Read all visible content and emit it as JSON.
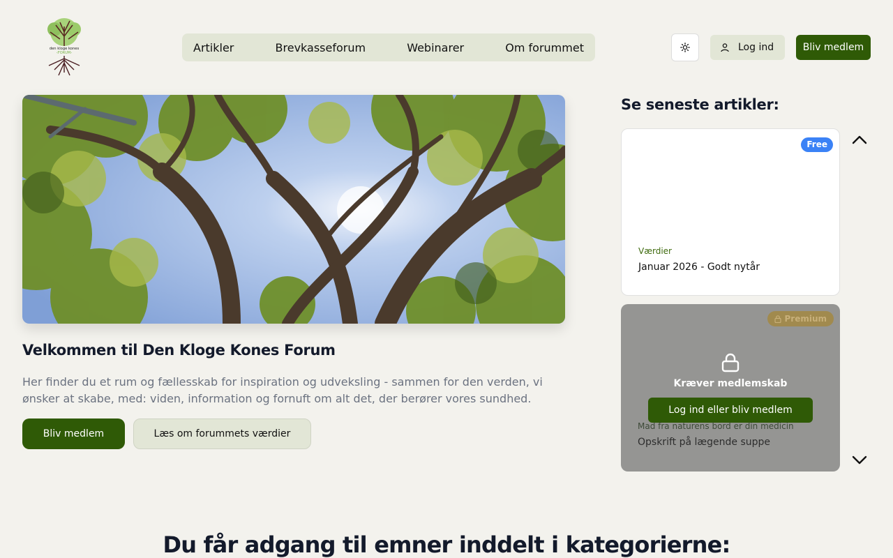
{
  "brand": {
    "logo_alt_line1": "den kloge kones",
    "logo_alt_line2": "FORUM"
  },
  "nav": {
    "items": [
      {
        "label": "Artikler"
      },
      {
        "label": "Brevkasseforum"
      },
      {
        "label": "Webinarer"
      },
      {
        "label": "Om forummet"
      }
    ]
  },
  "header": {
    "theme_icon": "sun-icon",
    "login_label": "Log ind",
    "login_icon": "user-icon",
    "join_label": "Bliv medlem"
  },
  "hero": {
    "title": "Velkommen til Den Kloge Kones Forum",
    "text": "Her finder du et rum og fællesskab for inspiration og udveksling - sammen for den verden, vi ønsker at skabe, med: viden, information og fornuft om alt det, der berører vores sundhed.",
    "join_label": "Bliv medlem",
    "values_label": "Læs om forummets værdier"
  },
  "sidebar": {
    "heading": "Se seneste artikler:",
    "cards": [
      {
        "badge": "Free",
        "category": "Værdier",
        "title": "Januar 2026 - Godt nytår"
      },
      {
        "badge": "Premium",
        "requires": "Kræver medlemskab",
        "cta": "Log ind eller bliv medlem",
        "category": "Mad fra naturens bord er din medicin",
        "title": "Opskrift på lægende suppe"
      }
    ]
  },
  "bottom": {
    "heading": "Du får adgang til emner inddelt i kategorierne:"
  },
  "colors": {
    "background": "#f3f2ed",
    "brand_green": "#2f5a06",
    "nav_bg": "#e2e6d6",
    "free_badge": "#3b82f6",
    "premium_badge": "#a18a4e"
  }
}
